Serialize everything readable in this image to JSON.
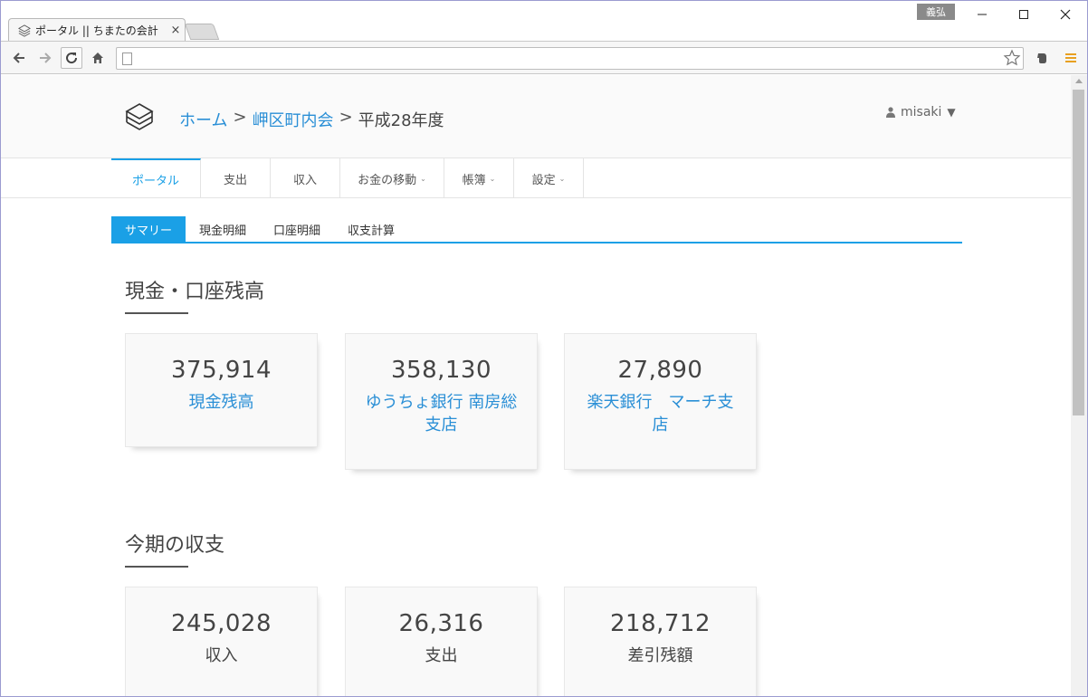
{
  "browser": {
    "tab": {
      "title": "ポータル || ちまたの会計",
      "close_glyph": "×"
    },
    "user_badge": "義弘",
    "window_controls": {
      "minimize": "—",
      "maximize": "☐",
      "close": "✕"
    },
    "toolbar": {
      "back_icon": "back-arrow-icon",
      "forward_icon": "forward-arrow-icon",
      "reload_icon": "reload-icon",
      "home_icon": "home-icon",
      "url": "",
      "bookmark_icon": "star-icon",
      "evernote_icon": "evernote-icon",
      "menu_icon": "hamburger-menu-icon"
    }
  },
  "header": {
    "breadcrumb": {
      "home": "ホーム",
      "org": "岬区町内会",
      "current": "平成28年度",
      "separator": ">"
    },
    "user": {
      "name": "misaki",
      "caret": "▼"
    }
  },
  "nav": {
    "items": [
      {
        "label": "ポータル",
        "active": true,
        "dropdown": false
      },
      {
        "label": "支出",
        "active": false,
        "dropdown": false
      },
      {
        "label": "収入",
        "active": false,
        "dropdown": false
      },
      {
        "label": "お金の移動",
        "active": false,
        "dropdown": true
      },
      {
        "label": "帳簿",
        "active": false,
        "dropdown": true
      },
      {
        "label": "設定",
        "active": false,
        "dropdown": true
      }
    ],
    "caret": "⌄"
  },
  "subtabs": [
    {
      "label": "サマリー",
      "active": true
    },
    {
      "label": "現金明細",
      "active": false
    },
    {
      "label": "口座明細",
      "active": false
    },
    {
      "label": "収支計算",
      "active": false
    }
  ],
  "balances": {
    "title": "現金・口座残高",
    "cards": [
      {
        "value": "375,914",
        "label": "現金残高"
      },
      {
        "value": "358,130",
        "label": "ゆうちょ銀行 南房総支店"
      },
      {
        "value": "27,890",
        "label": "楽天銀行　マーチ支店"
      }
    ]
  },
  "income_expense": {
    "title": "今期の収支",
    "cards": [
      {
        "value": "245,028",
        "label": "収入"
      },
      {
        "value": "26,316",
        "label": "支出"
      },
      {
        "value": "218,712",
        "label": "差引残額"
      }
    ]
  },
  "colors": {
    "accent": "#1aa0e6",
    "link": "#2a8fd6",
    "card_bg": "#f9f9f9"
  }
}
